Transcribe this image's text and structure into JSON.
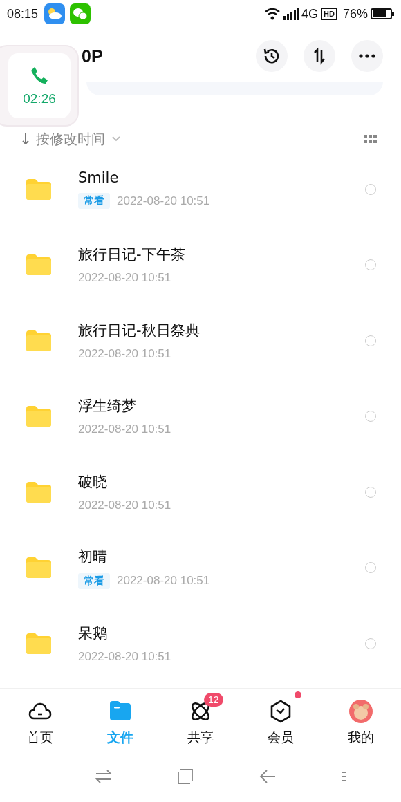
{
  "status_bar": {
    "time": "08:15",
    "network": "4G",
    "hd": "HD",
    "battery": "76%"
  },
  "header": {
    "title": "0P"
  },
  "call_bubble": {
    "duration": "02:26"
  },
  "sort": {
    "label": "按修改时间"
  },
  "files": [
    {
      "name": "Smile",
      "tag": "常看",
      "date": "2022-08-20  10:51",
      "selected": false
    },
    {
      "name": "旅行日记-下午茶",
      "date": "2022-08-20  10:51",
      "selected": false
    },
    {
      "name": "旅行日记-秋日祭典",
      "date": "2022-08-20  10:51",
      "selected": false
    },
    {
      "name": "浮生绮梦",
      "date": "2022-08-20  10:51",
      "selected": false
    },
    {
      "name": "破晓",
      "date": "2022-08-20  10:51",
      "selected": false
    },
    {
      "name": "初晴",
      "tag": "常看",
      "date": "2022-08-20  10:51",
      "selected": false
    },
    {
      "name": "呆鹅",
      "date": "2022-08-20  10:51",
      "selected": false
    }
  ],
  "tab_bar": [
    {
      "kind": "home",
      "label": "首页",
      "selected": false,
      "dot": false
    },
    {
      "kind": "files",
      "label": "文件",
      "selected": true,
      "dot": false
    },
    {
      "kind": "share",
      "label": "共享",
      "selected": false,
      "badge": "12",
      "dot": false
    },
    {
      "kind": "member",
      "label": "会员",
      "selected": false,
      "dot": true
    },
    {
      "kind": "me",
      "label": "我的",
      "selected": false,
      "dot": false
    }
  ]
}
